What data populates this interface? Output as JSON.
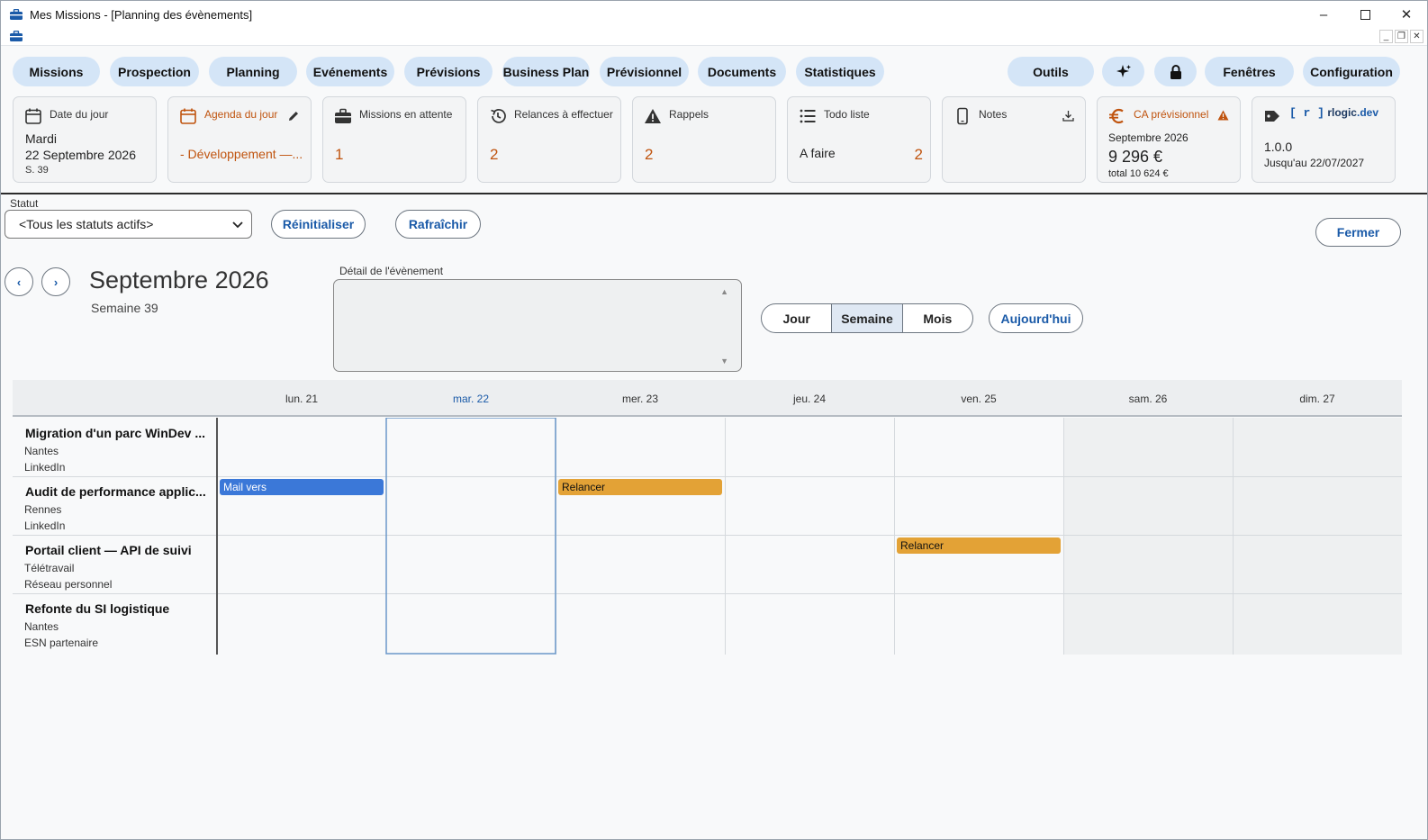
{
  "window": {
    "title": "Mes Missions - [Planning des évènements]"
  },
  "nav": {
    "missions": "Missions",
    "prospection": "Prospection",
    "planning": "Planning",
    "evenements": "Evénements",
    "previsions": "Prévisions",
    "business_plan": "Business Plan",
    "previsionnel": "Prévisionnel",
    "documents": "Documents",
    "statistiques": "Statistiques",
    "outils": "Outils",
    "fenetres": "Fenêtres",
    "configuration": "Configuration"
  },
  "cards": {
    "date_du_jour": {
      "label": "Date du jour",
      "day": "Mardi",
      "date": "22 Septembre 2026",
      "week": "S. 39"
    },
    "agenda": {
      "label": "Agenda du jour",
      "value": "- Développement —..."
    },
    "missions_attente": {
      "label": "Missions en attente",
      "value": "1"
    },
    "relances": {
      "label": "Relances à effectuer",
      "value": "2"
    },
    "rappels": {
      "label": "Rappels",
      "value": "2"
    },
    "todo": {
      "label": "Todo liste",
      "item": "A faire",
      "value": "2"
    },
    "notes": {
      "label": "Notes"
    },
    "ca": {
      "label": "CA prévisionnel",
      "month": "Septembre 2026",
      "amount": "9 296 €",
      "total": "total 10 624 €"
    },
    "licence": {
      "brand_bracket": "[ r ]",
      "brand_name": "rlogic",
      "brand_tld": ".dev",
      "version": "1.0.0",
      "until": "Jusqu'au 22/07/2027"
    }
  },
  "filters": {
    "statut_label": "Statut",
    "statut_value": "<Tous les statuts actifs>",
    "reset": "Réinitialiser",
    "refresh": "Rafraîchir",
    "close": "Fermer"
  },
  "calendar": {
    "prev": "‹",
    "next": "›",
    "month": "Septembre 2026",
    "week": "Semaine 39",
    "detail_label": "Détail de l'évènement",
    "views": {
      "day": "Jour",
      "week": "Semaine",
      "month": "Mois"
    },
    "today": "Aujourd'hui",
    "days": [
      "lun. 21",
      "mar. 22",
      "mer. 23",
      "jeu. 24",
      "ven. 25",
      "sam. 26",
      "dim. 27"
    ],
    "rows": [
      {
        "title": "Migration d'un parc WinDev ...",
        "city": "Nantes",
        "source": "LinkedIn"
      },
      {
        "title": "Audit de performance applic...",
        "city": "Rennes",
        "source": "LinkedIn"
      },
      {
        "title": "Portail client — API de suivi",
        "city": "Télétravail",
        "source": "Réseau personnel"
      },
      {
        "title": "Refonte du SI logistique",
        "city": "Nantes",
        "source": "ESN partenaire"
      }
    ],
    "events": [
      {
        "label": "Mail vers",
        "color": "#3b78d8"
      },
      {
        "label": "Relancer",
        "color": "#e3a236"
      },
      {
        "label": "Relancer",
        "color": "#e3a236"
      }
    ]
  }
}
